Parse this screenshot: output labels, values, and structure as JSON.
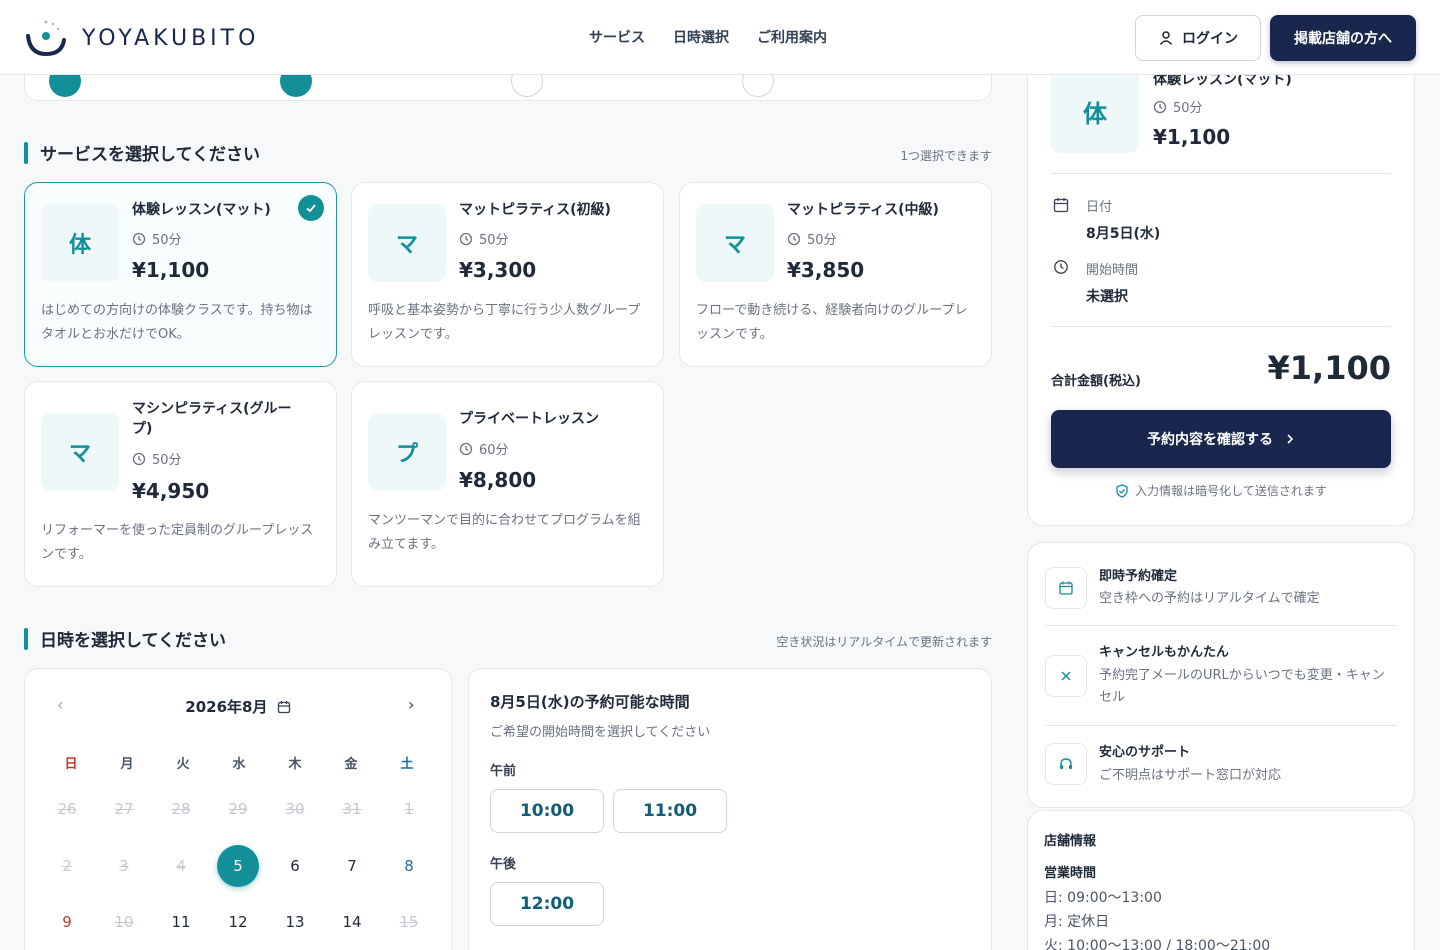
{
  "header": {
    "logo_text": "YOYAKUBITO",
    "nav": [
      "サービス",
      "日時選択",
      "ご利用案内"
    ],
    "login_label": "ログイン",
    "store_label": "掲載店舗の方へ"
  },
  "services_section": {
    "title": "サービスを選択してください",
    "note": "1つ選択できます",
    "items": [
      {
        "thumb": "体",
        "name": "体験レッスン(マット)",
        "duration": "50分",
        "price": "¥1,100",
        "desc": "はじめての方向けの体験クラスです。持ち物はタオルとお水だけでOK。",
        "selected": true
      },
      {
        "thumb": "マ",
        "name": "マットピラティス(初級)",
        "duration": "50分",
        "price": "¥3,300",
        "desc": "呼吸と基本姿勢から丁寧に行う少人数グループレッスンです。"
      },
      {
        "thumb": "マ",
        "name": "マットピラティス(中級)",
        "duration": "50分",
        "price": "¥3,850",
        "desc": "フローで動き続ける、経験者向けのグループレッスンです。"
      },
      {
        "thumb": "マ",
        "name": "マシンピラティス(グループ)",
        "duration": "50分",
        "price": "¥4,950",
        "desc": "リフォーマーを使った定員制のグループレッスンです。"
      },
      {
        "thumb": "プ",
        "name": "プライベートレッスン",
        "duration": "60分",
        "price": "¥8,800",
        "desc": "マンツーマンで目的に合わせてプログラムを組み立てます。"
      }
    ]
  },
  "datetime_section": {
    "title": "日時を選択してください",
    "note": "空き状況はリアルタイムで更新されます"
  },
  "calendar": {
    "month_label": "2026年8月",
    "weekdays": [
      "日",
      "月",
      "火",
      "水",
      "木",
      "金",
      "土"
    ],
    "rows": [
      [
        "26",
        "27",
        "28",
        "29",
        "30",
        "31",
        "1"
      ],
      [
        "2",
        "3",
        "4",
        "5",
        "6",
        "7",
        "8"
      ],
      [
        "9",
        "10",
        "11",
        "12",
        "13",
        "14",
        "15"
      ]
    ],
    "selected_day": "5"
  },
  "times": {
    "title": "8月5日(水)の予約可能な時間",
    "subtitle": "ご希望の開始時間を選択してください",
    "am_label": "午前",
    "am_slots": [
      "10:00",
      "11:00"
    ],
    "pm_label": "午後",
    "pm_slots": [
      "12:00"
    ]
  },
  "summary": {
    "thumb": "体",
    "name": "体験レッスン(マット)",
    "duration": "50分",
    "price": "¥1,100",
    "date_label": "日付",
    "date_value": "8月5日(水)",
    "time_label": "開始時間",
    "time_value": "未選択",
    "total_label": "合計金額(税込)",
    "total_value": "¥1,100",
    "confirm_label": "予約内容を確認する",
    "secure_note": "入力情報は暗号化して送信されます"
  },
  "features": [
    {
      "title": "即時予約確定",
      "desc": "空き枠への予約はリアルタイムで確定"
    },
    {
      "title": "キャンセルもかんたん",
      "desc": "予約完了メールのURLからいつでも変更・キャンセル"
    },
    {
      "title": "安心のサポート",
      "desc": "ご不明点はサポート窓口が対応"
    }
  ],
  "store": {
    "title": "店舗情報",
    "hours_title": "営業時間",
    "hours": [
      "日: 09:00〜13:00",
      "月: 定休日",
      "火: 10:00〜13:00 / 18:00〜21:00"
    ]
  },
  "colors": {
    "accent": "#138f99",
    "navy": "#19264e"
  }
}
